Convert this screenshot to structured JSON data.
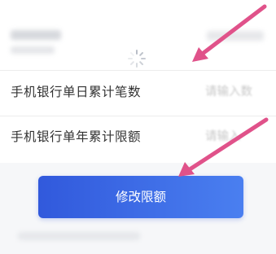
{
  "form": {
    "rows": [
      {
        "label": "手机银行单日累计笔数",
        "placeholder": "请输入数"
      },
      {
        "label": "手机银行单年累计限额",
        "placeholder": "请输入"
      }
    ]
  },
  "submit_button": {
    "label": "修改限额"
  },
  "colors": {
    "button_start": "#3159dc",
    "button_end": "#4a7ff0",
    "annotation_arrow": "#e0528a"
  },
  "icons": {
    "loading": "spinner-icon"
  }
}
